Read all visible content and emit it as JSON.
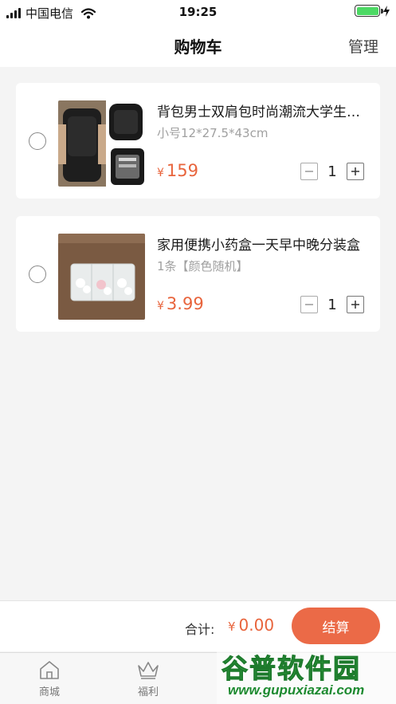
{
  "status_bar": {
    "carrier": "中国电信",
    "time": "19:25",
    "battery_level": 1.0,
    "charging": true
  },
  "header": {
    "title": "购物车",
    "manage_label": "管理"
  },
  "cart": {
    "items": [
      {
        "title": "背包男士双肩包时尚潮流大学生书包韩版",
        "spec": "小号12*27.5*43cm",
        "currency": "¥",
        "price": "159",
        "quantity": "1",
        "selected": false
      },
      {
        "title": "家用便携小药盒一天早中晚分装盒",
        "spec": "1条【颜色随机】",
        "currency": "¥",
        "price": "3.99",
        "quantity": "1",
        "selected": false
      }
    ]
  },
  "checkout": {
    "total_label": "合计:",
    "currency": "¥",
    "total_value": "0.00",
    "button_label": "结算"
  },
  "tabs": [
    {
      "label": "商城",
      "icon": "home-icon"
    },
    {
      "label": "福利",
      "icon": "crown-icon"
    }
  ],
  "watermark": {
    "title": "谷普软件园",
    "url": "www.gupuxiazai.com"
  },
  "colors": {
    "accent": "#eb6a47",
    "price": "#e8643c",
    "background": "#f4f4f4"
  }
}
